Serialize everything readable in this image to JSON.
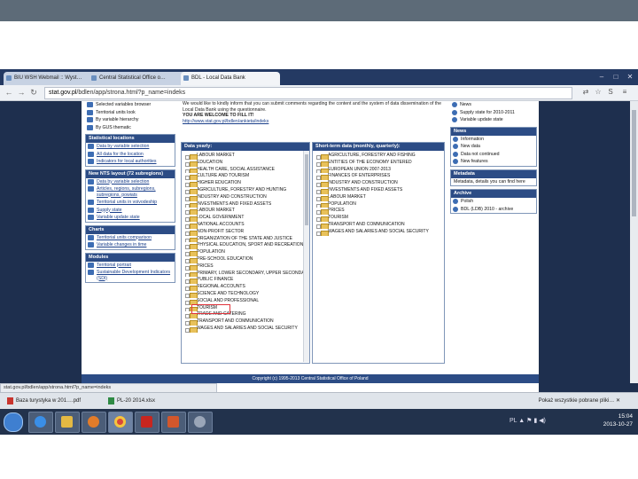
{
  "browser": {
    "tabs": [
      {
        "label": "BIU WSH Webmail :: Wyst…"
      },
      {
        "label": "Central Statistical Office o…"
      },
      {
        "label": "BDL - Local Data Bank"
      }
    ],
    "url_host": "stat.gov.pl",
    "url_path": "/bdlen/app/strona.html?p_name=indeks",
    "status_url": "stat.gov.pl/bdlen/app/strona.html?p_name=indeks"
  },
  "sidebar": {
    "top_items": [
      {
        "label": "Selected variables browser"
      },
      {
        "label": "Territorial units look"
      },
      {
        "label": "By variable hierarchy"
      },
      {
        "label": "By GUS thematic"
      }
    ],
    "sections": [
      {
        "title": "Statistical locations",
        "items": [
          {
            "label": "Data by variable selection"
          },
          {
            "label": "All data for the location"
          },
          {
            "label": "Indicators for local authorities"
          }
        ]
      },
      {
        "title": "New NTS layout (72 subregions)",
        "items": [
          {
            "label": "Data by variable selection"
          },
          {
            "label": "Articles, regions, subregions, subregions, powiats"
          },
          {
            "label": "Territorial units in voivodeship"
          },
          {
            "label": "Supply state"
          },
          {
            "label": "Variable update state"
          }
        ]
      },
      {
        "title": "Charts",
        "items": [
          {
            "label": "Territorial units comparison"
          },
          {
            "label": "Variable changes in time"
          }
        ]
      },
      {
        "title": "Modules",
        "items": [
          {
            "label": "Territorial portrait"
          },
          {
            "label": "Sustainable Development Indicators (SDI)"
          }
        ]
      }
    ]
  },
  "intro": {
    "text1": "We would like to kindly inform that you can submit comments regarding the content and the system of data dissemination of the Local Data Bank using the questionnaire.",
    "text2": "YOU ARE WELCOME TO FILL IT!",
    "text3": "http://www.stat.gov.pl/bdlen/ankieta/indeks"
  },
  "yearly": {
    "title": "Data yearly:",
    "items": [
      "LABOUR MARKET",
      "EDUCATION",
      "HEALTH CARE, SOCIAL ASSISTANCE",
      "CULTURE AND TOURISM",
      "HIGHER EDUCATION",
      "AGRICULTURE, FORESTRY AND HUNTING",
      "INDUSTRY AND CONSTRUCTION",
      "INVESTMENTS AND FIXED ASSETS",
      "LABOUR MARKET",
      "LOCAL GOVERNMENT",
      "NATIONAL ACCOUNTS",
      "NON-PROFIT SECTOR",
      "ORGANIZATION OF THE STATE AND JUSTICE",
      "PHYSICAL EDUCATION, SPORT AND RECREATION",
      "POPULATION",
      "PRE-SCHOOL EDUCATION",
      "PRICES",
      "PRIMARY, LOWER SECONDARY, UPPER SECONDARY",
      "PUBLIC FINANCE",
      "REGIONAL ACCOUNTS",
      "SCIENCE AND TECHNOLOGY",
      "SOCIAL AND PROFESSIONAL",
      "TOURISM",
      "TRADE AND CATERING",
      "TRANSPORT AND COMMUNICATION",
      "WAGES AND SALARIES AND SOCIAL SECURITY"
    ],
    "highlighted_index": 22
  },
  "shortterm": {
    "title": "Short-term data (monthly, quarterly):",
    "items": [
      "AGRICULTURE, FORESTRY AND FISHING",
      "ENTITIES OF THE ECONOMY ENTERED",
      "EUROPEAN UNION 2007-2013",
      "FINANCES OF ENTERPRISES",
      "INDUSTRY AND CONSTRUCTION",
      "INVESTMENTS AND FIXED ASSETS",
      "LABOUR MARKET",
      "POPULATION",
      "PRICES",
      "TOURISM",
      "TRANSPORT AND COMMUNICATION",
      "WAGES AND SALARIES AND SOCIAL SECURITY"
    ]
  },
  "right": {
    "top_items": [
      {
        "label": "News"
      },
      {
        "label": "Supply state for 2010-2011"
      },
      {
        "label": "Variable update state"
      }
    ],
    "sections": [
      {
        "title": "News",
        "items": [
          {
            "label": "Information"
          },
          {
            "label": "New data"
          },
          {
            "label": "Data not continued"
          },
          {
            "label": "New features"
          }
        ]
      },
      {
        "title": "Metadata",
        "items": [
          {
            "label": "Metadata, details you can find here"
          }
        ]
      },
      {
        "title": "Archive",
        "items": [
          {
            "label": "Polish"
          },
          {
            "label": "BDL (LDB) 2010 - archive"
          }
        ]
      }
    ]
  },
  "footer": {
    "text": "Copyright (c) 1995-2013 Central Statistical Office of Poland"
  },
  "downloads": {
    "item1": "Baza turystyka w 201….pdf",
    "item2": "PL-20 2014.xlsx",
    "show_all": "Pokaż wszystkie pobrane pliki…"
  },
  "taskbar": {
    "time": "15:04",
    "date": "2013-10-27",
    "lang": "PL"
  }
}
